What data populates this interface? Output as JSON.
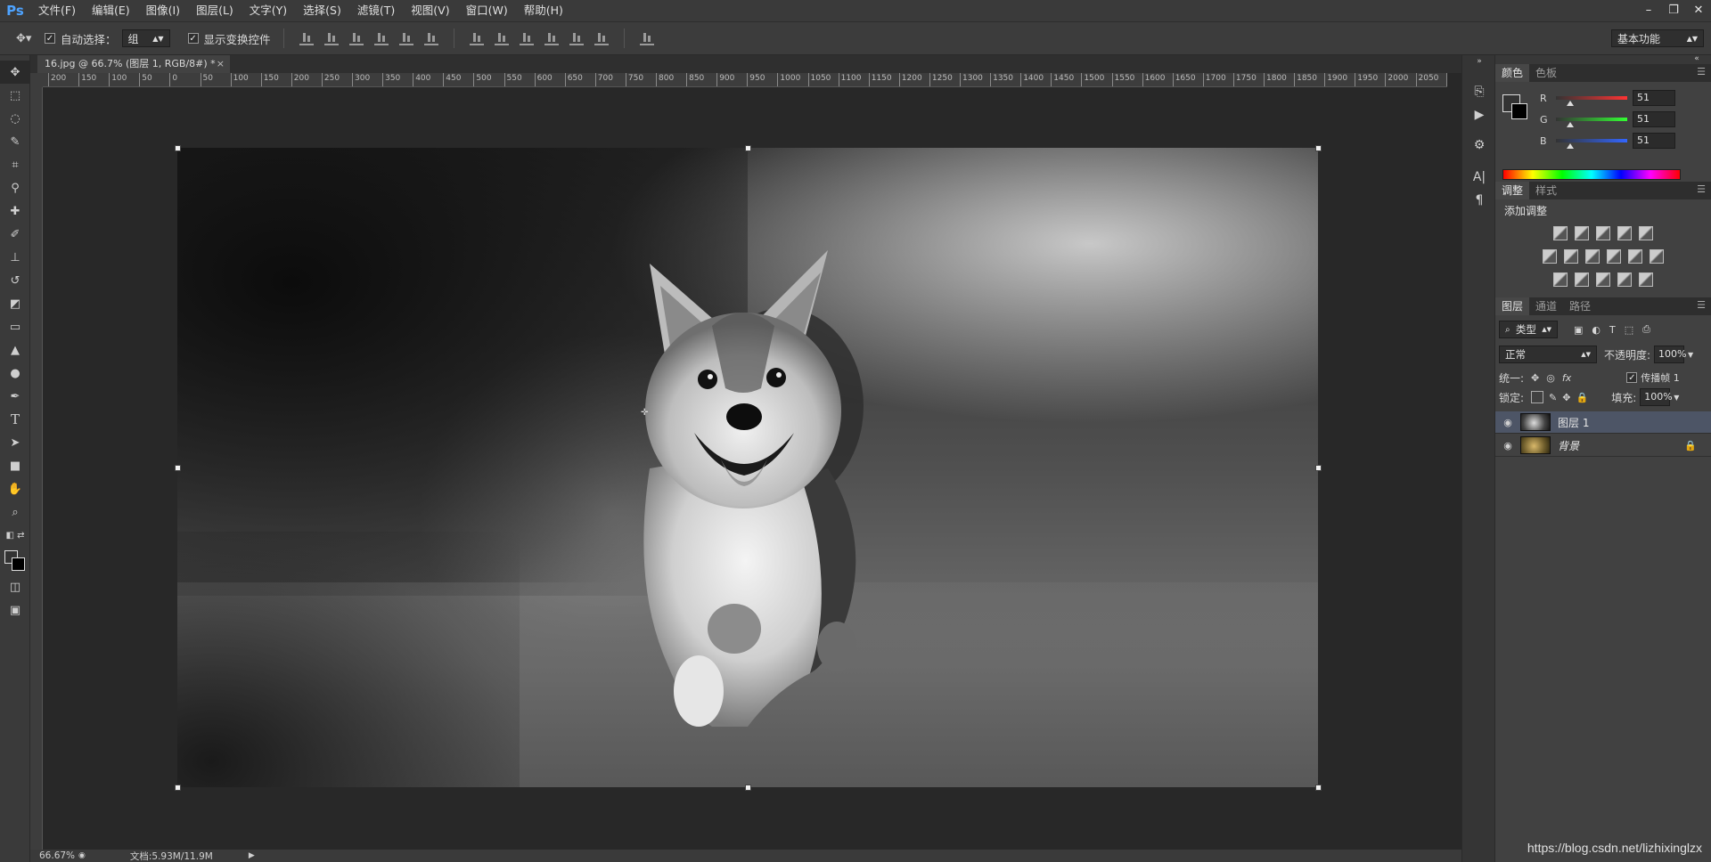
{
  "app": {
    "logo": "Ps"
  },
  "menubar": {
    "items": [
      "文件(F)",
      "编辑(E)",
      "图像(I)",
      "图层(L)",
      "文字(Y)",
      "选择(S)",
      "滤镜(T)",
      "视图(V)",
      "窗口(W)",
      "帮助(H)"
    ],
    "window_controls": [
      "–",
      "❐",
      "✕"
    ]
  },
  "options": {
    "auto_select_label": "自动选择：",
    "auto_select_value": "组",
    "show_transform_label": "显示变换控件",
    "workspace": "基本功能"
  },
  "document": {
    "tab_title": "16.jpg @ 66.7% (图层 1, RGB/8#) *",
    "close_glyph": "×"
  },
  "rulers": {
    "top_ticks": [
      "200",
      "150",
      "100",
      "50",
      "0",
      "50",
      "100",
      "150",
      "200",
      "250",
      "300",
      "350",
      "400",
      "450",
      "500",
      "550",
      "600",
      "650",
      "700",
      "750",
      "800",
      "850",
      "900",
      "950",
      "1000",
      "1050",
      "1100",
      "1150",
      "1200",
      "1250",
      "1300",
      "1350",
      "1400",
      "1450",
      "1500",
      "1550",
      "1600",
      "1650",
      "1700",
      "1750",
      "1800",
      "1850",
      "1900",
      "1950",
      "2000",
      "2050",
      "2100"
    ]
  },
  "statusbar": {
    "zoom": "66.67%",
    "doc_info": "文档:5.93M/11.9M",
    "arrow": "▶"
  },
  "panels": {
    "color": {
      "tabs": [
        "颜色",
        "色板"
      ],
      "r_label": "R",
      "g_label": "G",
      "b_label": "B",
      "r_value": "51",
      "g_value": "51",
      "b_value": "51",
      "r_fraction": 0.2,
      "g_fraction": 0.2,
      "b_fraction": 0.2
    },
    "adjustments": {
      "tabs": [
        "调整",
        "样式"
      ],
      "title": "添加调整"
    },
    "layers": {
      "tabs": [
        "图层",
        "通道",
        "路径"
      ],
      "filter_kind": "类型",
      "blend_mode": "正常",
      "opacity_label": "不透明度:",
      "opacity_value": "100%",
      "unify_label": "统一:",
      "propagate_label": "传播帧 1",
      "lock_label": "锁定:",
      "fill_label": "填充:",
      "fill_value": "100%",
      "items": [
        {
          "name": "图层 1",
          "selected": true
        },
        {
          "name": "背景",
          "locked": true
        }
      ]
    }
  },
  "watermark": "https://blog.csdn.net/lizhixinglzx",
  "colors": {
    "accent_blue": "#4ea3ff",
    "selection": "#4d5566"
  }
}
